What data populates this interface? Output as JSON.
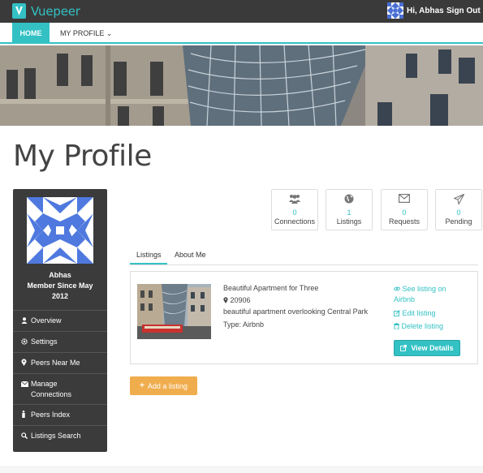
{
  "brand": {
    "name": "Vuepeer",
    "accent": "#33c1c4"
  },
  "topbar": {
    "greeting": "Hi, Abhas",
    "signout_label": "Sign Out"
  },
  "nav": {
    "home_label": "HOME",
    "profile_label": "MY PROFILE ⌄"
  },
  "page": {
    "title": "My Profile"
  },
  "sidebar": {
    "user_name": "Abhas",
    "member_since": "Member Since May 2012",
    "items": [
      {
        "icon": "user-icon",
        "label": "Overview"
      },
      {
        "icon": "gear-icon",
        "label": "Settings"
      },
      {
        "icon": "map-marker-icon",
        "label": "Peers Near Me"
      },
      {
        "icon": "envelope-icon",
        "label": "Manage Connections"
      },
      {
        "icon": "person-icon",
        "label": "Peers Index"
      },
      {
        "icon": "search-icon",
        "label": "Listings Search"
      }
    ]
  },
  "stats": [
    {
      "icon": "users-icon",
      "count": "0",
      "label": "Connections"
    },
    {
      "icon": "globe-icon",
      "count": "1",
      "label": "Listings"
    },
    {
      "icon": "envelope-icon",
      "count": "0",
      "label": "Requests"
    },
    {
      "icon": "paper-plane-icon",
      "count": "0",
      "label": "Pending"
    }
  ],
  "tabs": [
    {
      "label": "Listings",
      "active": true
    },
    {
      "label": "About Me",
      "active": false
    }
  ],
  "listing": {
    "title": "Beautiful Apartment for Three",
    "zip": "20906",
    "description": "beautiful apartment overlooking Central Park",
    "type": "Type: Airbnb",
    "see_listing": "See listing on Airbnb",
    "edit": "Edit listing",
    "delete": "Delete listing",
    "view_details": "View Details"
  },
  "add_listing_label": "Add a listing"
}
